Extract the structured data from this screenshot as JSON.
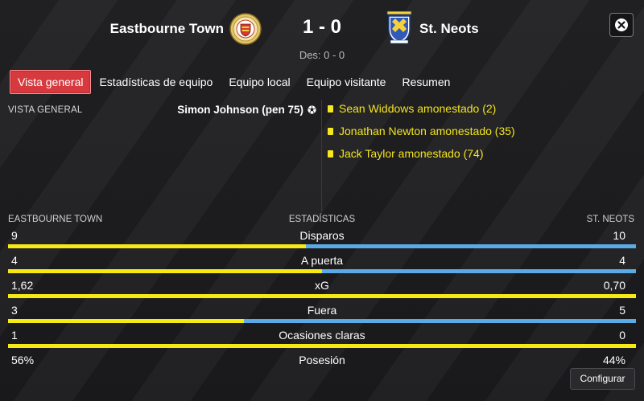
{
  "match": {
    "home_team": "Eastbourne Town",
    "away_team": "St. Neots",
    "score": "1 - 0",
    "halftime": "Des: 0 - 0"
  },
  "tabs": [
    {
      "label": "Vista general",
      "active": true
    },
    {
      "label": "Estadísticas de equipo",
      "active": false
    },
    {
      "label": "Equipo local",
      "active": false
    },
    {
      "label": "Equipo visitante",
      "active": false
    },
    {
      "label": "Resumen",
      "active": false
    }
  ],
  "overview": {
    "section_label": "VISTA GENERAL",
    "home_events": [
      {
        "text": "Simon Johnson (pen 75)",
        "icon": "ball-icon"
      }
    ],
    "away_events": [
      {
        "text": "Sean Widdows amonestado (2)",
        "icon": "yellow-card-icon"
      },
      {
        "text": "Jonathan Newton amonestado (35)",
        "icon": "yellow-card-icon"
      },
      {
        "text": "Jack Taylor amonestado (74)",
        "icon": "yellow-card-icon"
      }
    ]
  },
  "stats": {
    "home_header": "EASTBOURNE TOWN",
    "center_header": "ESTADÍSTICAS",
    "away_header": "ST. NEOTS",
    "rows": [
      {
        "label": "Disparos",
        "home": "9",
        "away": "10",
        "home_share": 0.474
      },
      {
        "label": "A puerta",
        "home": "4",
        "away": "4",
        "home_share": 0.5
      },
      {
        "label": "xG",
        "home": "1,62",
        "away": "0,70",
        "home_share": 1.0
      },
      {
        "label": "Fuera",
        "home": "3",
        "away": "5",
        "home_share": 0.375
      },
      {
        "label": "Ocasiones claras",
        "home": "1",
        "away": "0",
        "home_share": 1.0
      },
      {
        "label": "Posesión",
        "home": "56%",
        "away": "44%",
        "home_share": 0.56
      }
    ]
  },
  "colors": {
    "home_bar": "#f6ea14",
    "away_bar": "#5aaae6",
    "active_tab": "#d63a3f",
    "card_text": "#f4e41e"
  },
  "buttons": {
    "configure": "Configurar",
    "close_icon": "close-icon"
  }
}
